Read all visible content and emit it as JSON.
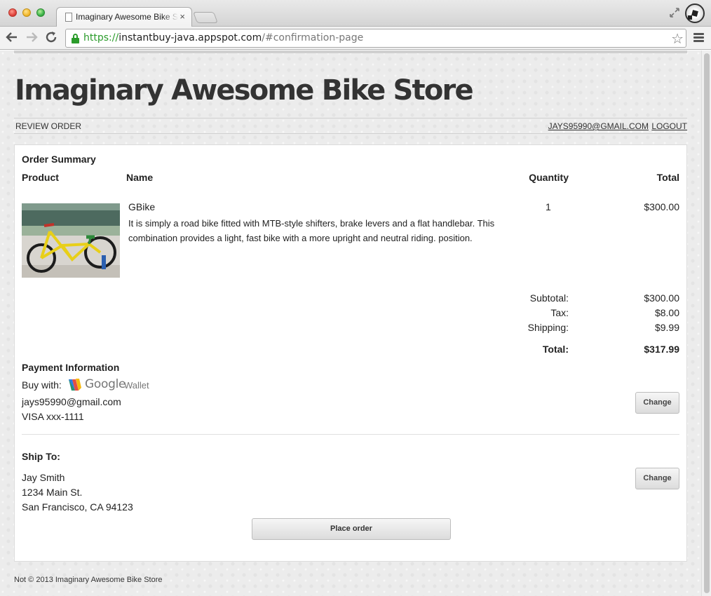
{
  "browser": {
    "tab_title": "Imaginary Awesome Bike Store",
    "tab_close": "×",
    "url_scheme": "https://",
    "url_host": "instantbuy-java.appspot.com",
    "url_path": "/#confirmation-page"
  },
  "header": {
    "store_title": "Imaginary Awesome Bike Store",
    "crumb": "REVIEW ORDER",
    "user_email_link": "JAYS95990@GMAIL.COM",
    "logout_link": "LOGOUT"
  },
  "order_summary": {
    "heading": "Order Summary",
    "columns": {
      "product": "Product",
      "name": "Name",
      "quantity": "Quantity",
      "total": "Total"
    },
    "item": {
      "name": "GBike",
      "description": "It is simply a road bike fitted with MTB-style shifters, brake levers and a flat handlebar. This combination provides a light, fast bike with a more upright and neutral riding. position.",
      "quantity": "1",
      "total": "$300.00"
    },
    "totals": {
      "subtotal_label": "Subtotal:",
      "subtotal_value": "$300.00",
      "tax_label": "Tax:",
      "tax_value": "$8.00",
      "shipping_label": "Shipping:",
      "shipping_value": "$9.99",
      "total_label": "Total:",
      "total_value": "$317.99"
    }
  },
  "payment": {
    "heading": "Payment Information",
    "buy_with_label": "Buy with:",
    "wallet_word_google": "Google",
    "wallet_word_wallet": "Wallet",
    "email": "jays95990@gmail.com",
    "card": "VISA xxx-1111",
    "change_label": "Change"
  },
  "shipping": {
    "heading": "Ship To:",
    "name": "Jay Smith",
    "street": "1234 Main St.",
    "city_line": "San Francisco, CA 94123",
    "change_label": "Change"
  },
  "actions": {
    "place_order_label": "Place order"
  },
  "footer": {
    "text": "Not © 2013 Imaginary Awesome Bike Store"
  },
  "colors": {
    "secure_green": "#2a9b2a",
    "page_bg": "#ececec",
    "button_text": "#444444"
  }
}
